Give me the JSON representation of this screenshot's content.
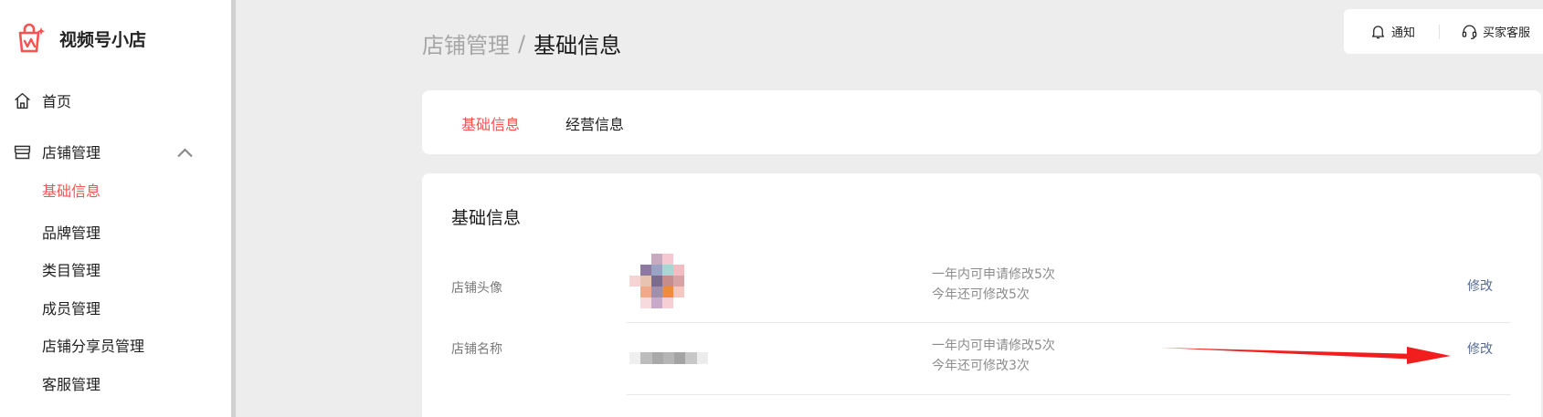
{
  "app": {
    "name": "视频号小店"
  },
  "sidebar": {
    "home_label": "首页",
    "shop_label": "店铺管理",
    "sub_items": [
      "基础信息",
      "品牌管理",
      "类目管理",
      "成员管理",
      "店铺分享员管理",
      "客服管理"
    ],
    "active_sub_item": "基础信息"
  },
  "toolbar": {
    "notify_label": "通知",
    "service_label": "买家客服"
  },
  "breadcrumb": {
    "parent": "店铺管理",
    "separator": "/",
    "current": "基础信息"
  },
  "tabs": [
    {
      "label": "基础信息",
      "active": true
    },
    {
      "label": "经营信息",
      "active": false
    }
  ],
  "section": {
    "title": "基础信息"
  },
  "rows": [
    {
      "label": "店铺头像",
      "note_line1": "一年内可申请修改5次",
      "note_line2": "今年还可修改5次",
      "action": "修改"
    },
    {
      "label": "店铺名称",
      "note_line1": "一年内可申请修改5次",
      "note_line2": "今年还可修改3次",
      "action": "修改"
    }
  ],
  "colors": {
    "accent": "#fa5151",
    "link": "#576b95",
    "annotation_arrow": "#f21d1d",
    "background": "#ededed"
  },
  "icons": {
    "brand": "shop-bag-logo-icon",
    "home": "home-icon",
    "shop": "store-icon",
    "expand": "chevron-up-icon",
    "notify": "bell-icon",
    "service": "headset-icon"
  }
}
